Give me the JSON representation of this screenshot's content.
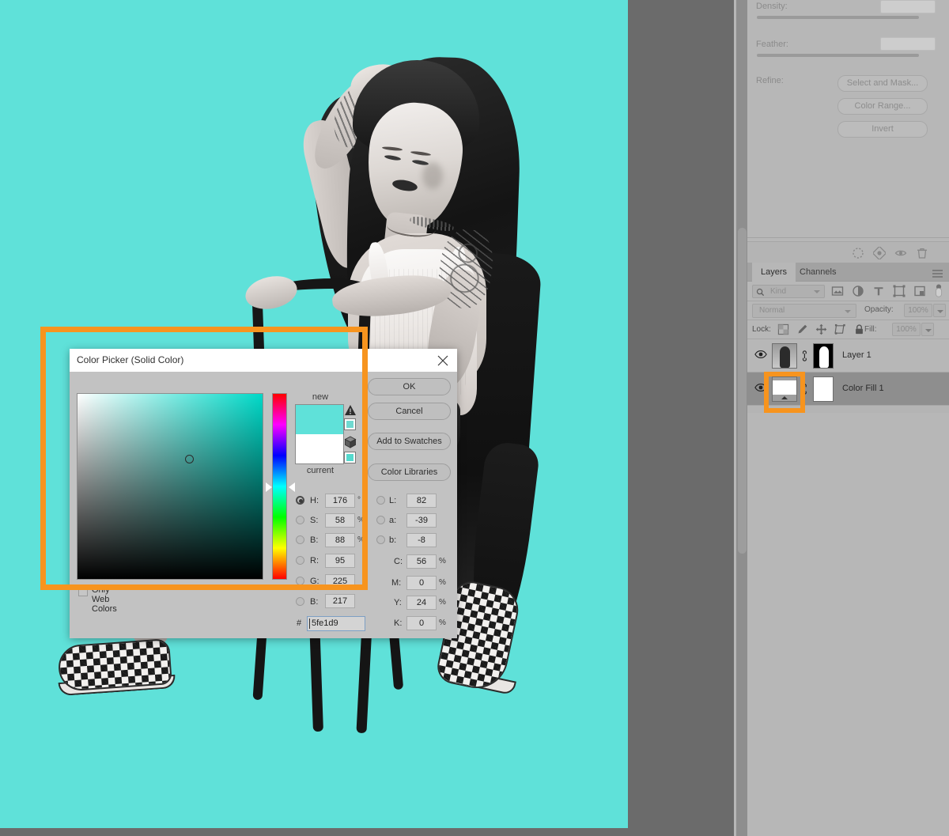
{
  "app": {
    "canvas_color": "#5fe1d9",
    "workspace_color": "#6b6b6b",
    "annotation_color": "#f7941e"
  },
  "properties_panel": {
    "density_label": "Density:",
    "feather_label": "Feather:",
    "refine_label": "Refine:",
    "buttons": [
      {
        "label": "Select and Mask..."
      },
      {
        "label": "Color Range..."
      },
      {
        "label": "Invert"
      }
    ],
    "footer_icons": [
      {
        "name": "load-selection-icon"
      },
      {
        "name": "apply-mask-icon"
      },
      {
        "name": "toggle-mask-icon"
      },
      {
        "name": "delete-mask-icon"
      }
    ]
  },
  "layers_panel": {
    "tabs": [
      {
        "label": "Layers",
        "active": true
      },
      {
        "label": "Channels",
        "active": false
      }
    ],
    "menu_icon": "panel-menu-icon",
    "filter": {
      "kind_label": "Kind",
      "search_icon": "search-icon",
      "icons": [
        {
          "name": "filter-pixel-icon"
        },
        {
          "name": "filter-adjustment-icon"
        },
        {
          "name": "filter-type-icon"
        },
        {
          "name": "filter-shape-icon"
        },
        {
          "name": "filter-smart-object-icon"
        },
        {
          "name": "filter-toggle-icon"
        }
      ]
    },
    "blend_mode": "Normal",
    "opacity_label": "Opacity:",
    "opacity_value": "100%",
    "lock_label": "Lock:",
    "lock_icons": [
      {
        "name": "lock-transparent-pixels-icon"
      },
      {
        "name": "lock-image-pixels-icon"
      },
      {
        "name": "lock-position-icon"
      },
      {
        "name": "lock-artboard-icon"
      },
      {
        "name": "lock-all-icon"
      }
    ],
    "fill_label": "Fill:",
    "fill_value": "100%",
    "layers": [
      {
        "name": "Layer 1",
        "visible": true,
        "selected": false,
        "thumb": "photo",
        "mask": "black-white"
      },
      {
        "name": "Color Fill 1",
        "visible": true,
        "selected": true,
        "thumb": "solid-color-fill",
        "mask": "white"
      }
    ]
  },
  "color_picker": {
    "title": "Color Picker (Solid Color)",
    "close_icon": "close-icon",
    "new_label": "new",
    "current_label": "current",
    "new_color": "#5fe1d9",
    "current_color": "#ffffff",
    "out_of_gamut_icon": "gamut-warning-icon",
    "web_safe_icon": "web-safe-warning-icon",
    "buttons": [
      {
        "label": "OK"
      },
      {
        "label": "Cancel"
      },
      {
        "label": "Add to Swatches"
      },
      {
        "label": "Color Libraries"
      }
    ],
    "only_web_colors": {
      "label": "Only Web Colors",
      "checked": false
    },
    "hsb": [
      {
        "key": "H:",
        "value": "176",
        "unit": "°",
        "selected": true
      },
      {
        "key": "S:",
        "value": "58",
        "unit": "%",
        "selected": false
      },
      {
        "key": "B:",
        "value": "88",
        "unit": "%",
        "selected": false
      }
    ],
    "rgb": [
      {
        "key": "R:",
        "value": "95",
        "unit": "",
        "selected": false
      },
      {
        "key": "G:",
        "value": "225",
        "unit": "",
        "selected": false
      },
      {
        "key": "B:",
        "value": "217",
        "unit": "",
        "selected": false
      }
    ],
    "lab": [
      {
        "key": "L:",
        "value": "82",
        "unit": "",
        "selected": false
      },
      {
        "key": "a:",
        "value": "-39",
        "unit": "",
        "selected": false
      },
      {
        "key": "b:",
        "value": "-8",
        "unit": "",
        "selected": false
      }
    ],
    "cmyk": [
      {
        "key": "C:",
        "value": "56",
        "unit": "%"
      },
      {
        "key": "M:",
        "value": "0",
        "unit": "%"
      },
      {
        "key": "Y:",
        "value": "24",
        "unit": "%"
      },
      {
        "key": "K:",
        "value": "0",
        "unit": "%"
      }
    ],
    "hex_prefix": "#",
    "hex_value": "5fe1d9"
  }
}
